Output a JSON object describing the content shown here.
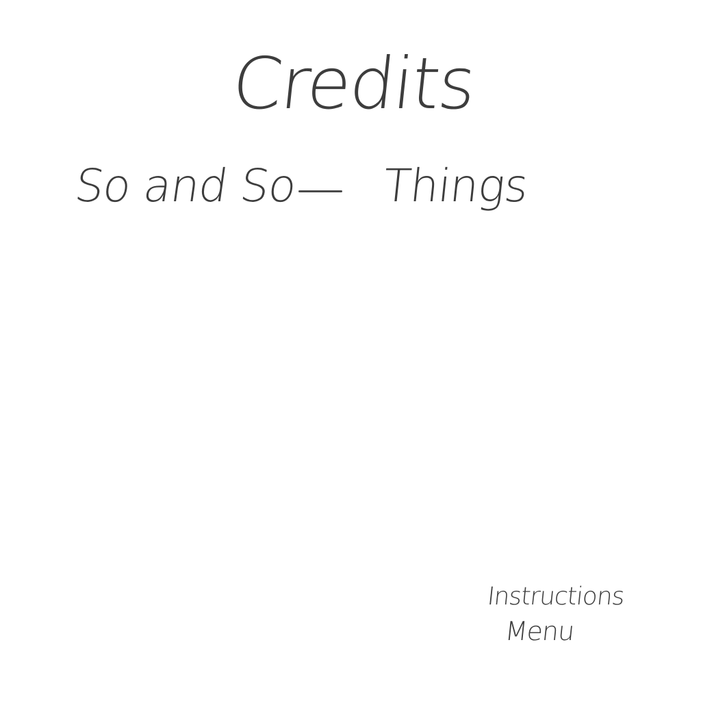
{
  "screen": {
    "title": "Credits",
    "credits": [
      {
        "name": "So and So",
        "dash": "—",
        "role": "Things"
      }
    ]
  },
  "navigation": {
    "instructions_label": "Instructions",
    "menu_label": "Menu"
  }
}
